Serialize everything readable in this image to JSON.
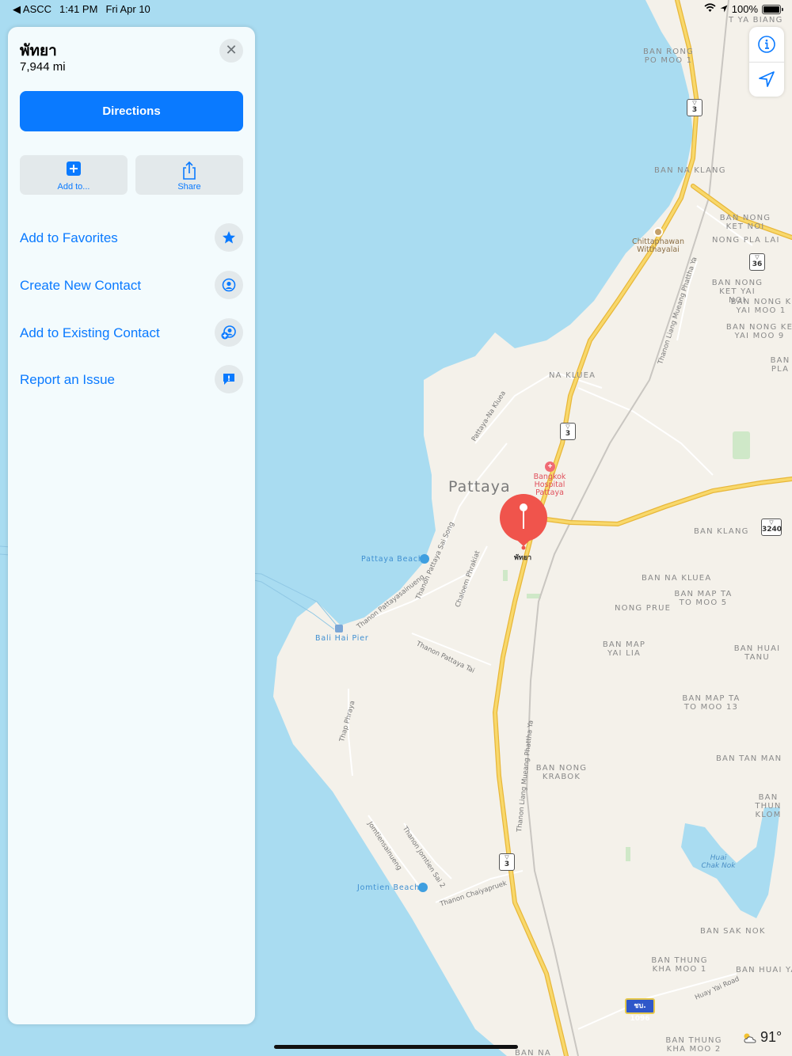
{
  "status_bar": {
    "back_app": "◀ ASCC",
    "time": "1:41 PM",
    "date": "Fri Apr 10",
    "battery": "100%"
  },
  "panel": {
    "title": "พัทยา",
    "distance": "7,944 mi",
    "close_glyph": "✕",
    "directions_label": "Directions",
    "add_to_label": "Add to...",
    "share_label": "Share",
    "menu": [
      {
        "label": "Add to Favorites",
        "icon": "star-icon"
      },
      {
        "label": "Create New Contact",
        "icon": "contact-icon"
      },
      {
        "label": "Add to Existing Contact",
        "icon": "add-contact-icon"
      },
      {
        "label": "Report an Issue",
        "icon": "report-icon"
      }
    ]
  },
  "map": {
    "city": "Pattaya",
    "pin_label": "พัทยา",
    "areas": [
      "BAN RONG PO MOO 1",
      "BAN NA KLANG",
      "BAN NONG KET NOI",
      "NONG PLA LAI",
      "BAN NONG KET YAI NOI",
      "BAN NONG K YAI MOO 1",
      "BAN NONG KE YAI MOO 9",
      "BAN PLA",
      "NA KLUEA",
      "BAN KLANG",
      "BAN NA KLUEA",
      "BAN MAP TA TO MOO 5",
      "NONG PRUE",
      "BAN MAP YAI LIA",
      "BAN HUAI TANU",
      "BAN MAP TA TO MOO 13",
      "BAN TAN MAN",
      "BAN NONG KRABOK",
      "BAN THUN KLOM",
      "BAN SAK NOK",
      "BAN THUNG KHA MOO 1",
      "BAN HUAI YA",
      "BAN THUNG KHA MOO 2",
      "BAN NA",
      "T YA BIANG"
    ],
    "roads": [
      "Pattaya-Na Kluea",
      "Thanon Pattaya Sai Song",
      "Chaloem Phrakiat",
      "Thanon Pattayasainueng",
      "Thanon Pattaya Tai",
      "Thap Phraya",
      "Jomtiensainueng",
      "Thanon Jomtien Sai 2",
      "Thanon Chaiyapruek",
      "Thanon Liang Mueang Phattha Ya",
      "Thanon Liang Mueang Phattha Ya",
      "Huay Yai Road"
    ],
    "pois": {
      "school": "Chittaphawan Witthayalai",
      "hospital": "Bangkok Hospital Pattaya",
      "pattaya_beach": "Pattaya Beach",
      "jomtien_beach": "Jomtien Beach",
      "pier": "Bali Hai Pier",
      "lake": "Huai Chak Nok"
    },
    "shields": [
      "3",
      "36",
      "3",
      "3240",
      "3"
    ],
    "blue_shield": "ชบ. 1096"
  },
  "weather": {
    "temperature": "91°",
    "icon": "partly-cloudy-icon"
  },
  "colors": {
    "accent": "#0a7aff",
    "water": "#a9dcf1",
    "land": "#f4f1ea",
    "highway": "#f5cd55",
    "pin": "#f0544c"
  }
}
